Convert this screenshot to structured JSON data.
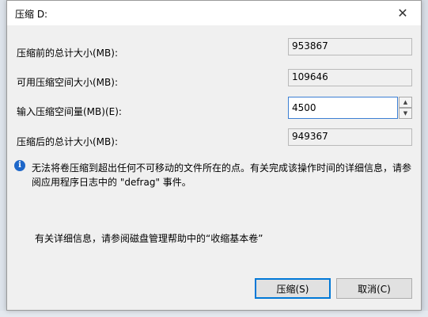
{
  "dialog": {
    "title": "压缩 D:",
    "close_glyph": "✕"
  },
  "fields": {
    "total_before": {
      "label": "压缩前的总计大小(MB):",
      "value": "953867"
    },
    "available": {
      "label": "可用压缩空间大小(MB):",
      "value": "109646"
    },
    "shrink_amount": {
      "label": "输入压缩空间量(MB)(E):",
      "value": "4500"
    },
    "total_after": {
      "label": "压缩后的总计大小(MB):",
      "value": "949367"
    }
  },
  "info": {
    "icon": "info-icon",
    "message": "无法将卷压缩到超出任何不可移动的文件所在的点。有关完成该操作时间的详细信息，请参阅应用程序日志中的 \"defrag\" 事件。"
  },
  "help_text": "有关详细信息，请参阅磁盘管理帮助中的“收缩基本卷”",
  "buttons": {
    "compress": "压缩(S)",
    "cancel": "取消(C)"
  },
  "colors": {
    "accent": "#0078d7",
    "info": "#1e67c9"
  }
}
